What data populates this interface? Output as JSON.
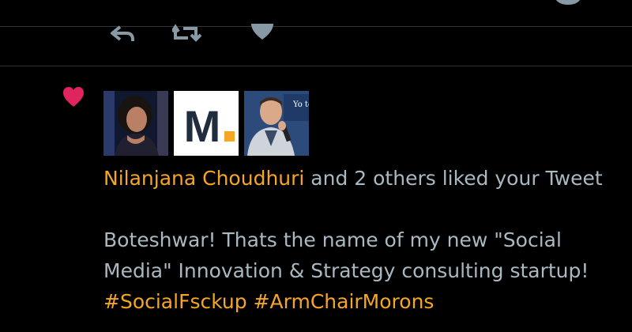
{
  "theme": {
    "background": "#000000",
    "accent": "#f5a623",
    "text": "#aab8c2",
    "like_heart": "#e0245e",
    "divider": "#2f3336"
  },
  "top_nav": {
    "icons": [
      "home-icon",
      "search-icon",
      "notifications-icon",
      "messages-icon",
      "profile-icon"
    ]
  },
  "previous_tweet_actions": {
    "icons": [
      "reply-icon",
      "retweet-icon",
      "like-icon"
    ]
  },
  "notification": {
    "type_icon": "heart-icon",
    "avatars": [
      {
        "name": "avatar-nilanjana",
        "icon": "user-photo"
      },
      {
        "name": "avatar-m-logo",
        "letter": "M",
        "dot_color": "#f5a623"
      },
      {
        "name": "avatar-speaker",
        "icon": "user-photo",
        "banner_text": "Yo term"
      }
    ],
    "liker_name": "Nilanjana Choudhuri",
    "action_text": " and 2 others liked your Tweet",
    "tweet": {
      "text_part1": "Boteshwar! Thats the name of my new \"Social Media\" Innovation & Strategy consulting startup! ",
      "hashtag1": "#SocialFsckup",
      "hashtag2": "#ArmChairMorons"
    }
  }
}
